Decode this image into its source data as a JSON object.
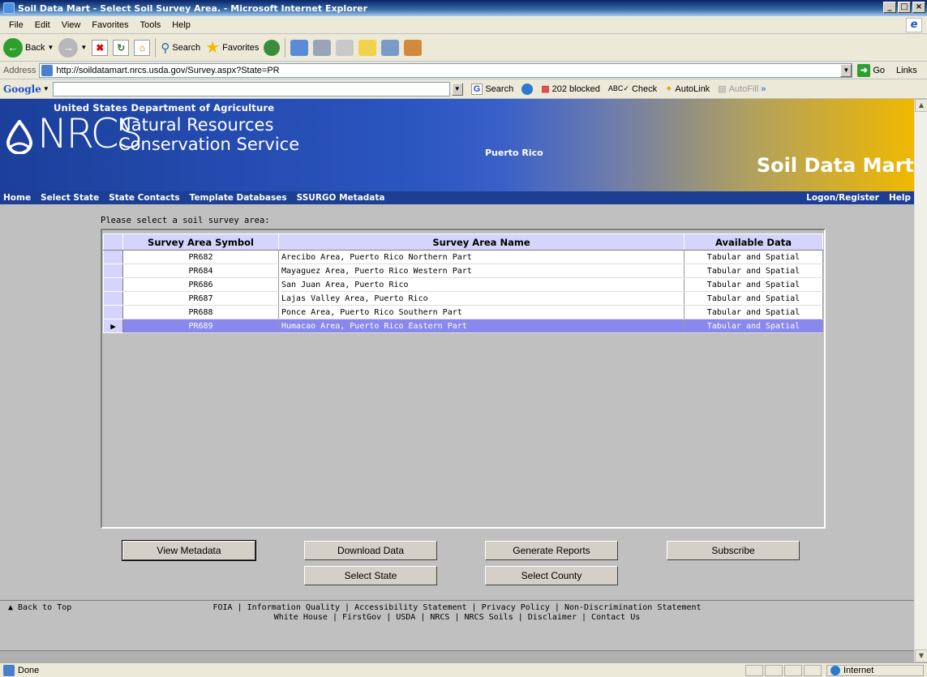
{
  "window": {
    "title": "Soil Data Mart - Select Soil Survey Area. - Microsoft Internet Explorer",
    "minimize": "_",
    "maximize": "□",
    "close": "×"
  },
  "menu": [
    "File",
    "Edit",
    "View",
    "Favorites",
    "Tools",
    "Help"
  ],
  "toolbar": {
    "back": "Back",
    "search": "Search",
    "favorites": "Favorites"
  },
  "address": {
    "label": "Address",
    "url": "http://soildatamart.nrcs.usda.gov/Survey.aspx?State=PR",
    "go": "Go",
    "links": "Links"
  },
  "googlebar": {
    "logo": "Google",
    "search": "Search",
    "blocked": "202 blocked",
    "check": "Check",
    "autolink": "AutoLink",
    "autofill": "AutoFill"
  },
  "banner": {
    "usda": "United States Department of Agriculture",
    "nrcs": "NRCS",
    "name1": "Natural Resources",
    "name2": "Conservation Service",
    "state": "Puerto Rico",
    "title": "Soil Data Mart"
  },
  "nav": {
    "left": [
      "Home",
      "Select State",
      "State Contacts",
      "Template Databases",
      "SSURGO Metadata"
    ],
    "right": [
      "Logon/Register",
      "Help"
    ]
  },
  "prompt": "Please select a soil survey area:",
  "grid": {
    "headers": [
      "Survey Area Symbol",
      "Survey Area Name",
      "Available Data"
    ],
    "rows": [
      {
        "symbol": "PR682",
        "name": "Arecibo Area, Puerto Rico Northern Part",
        "data": "Tabular and Spatial"
      },
      {
        "symbol": "PR684",
        "name": "Mayaguez Area, Puerto Rico Western Part",
        "data": "Tabular and Spatial"
      },
      {
        "symbol": "PR686",
        "name": "San Juan Area, Puerto Rico",
        "data": "Tabular and Spatial"
      },
      {
        "symbol": "PR687",
        "name": "Lajas Valley Area, Puerto Rico",
        "data": "Tabular and Spatial"
      },
      {
        "symbol": "PR688",
        "name": "Ponce Area, Puerto Rico Southern Part",
        "data": "Tabular and Spatial"
      },
      {
        "symbol": "PR689",
        "name": "Humacao Area, Puerto Rico Eastern Part",
        "data": "Tabular and Spatial"
      }
    ],
    "selected_index": 5
  },
  "buttons": {
    "view_metadata": "View Metadata",
    "download_data": "Download Data",
    "generate_reports": "Generate Reports",
    "subscribe": "Subscribe",
    "select_state": "Select State",
    "select_county": "Select County"
  },
  "footer": {
    "back_to_top": "▲ Back to Top",
    "line1": "FOIA | Information Quality | Accessibility Statement | Privacy Policy | Non-Discrimination Statement",
    "line2": "White House | FirstGov | USDA | NRCS | NRCS Soils | Disclaimer | Contact Us"
  },
  "status": {
    "text": "Done",
    "zone": "Internet"
  }
}
